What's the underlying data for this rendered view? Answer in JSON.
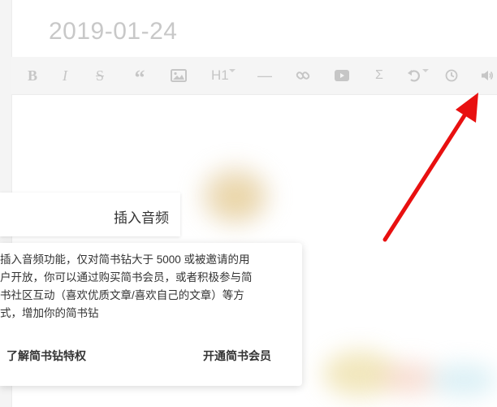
{
  "document": {
    "title": "2019-01-24"
  },
  "toolbar": {
    "buttons": [
      {
        "name": "bold",
        "glyph": "B"
      },
      {
        "name": "italic",
        "glyph": "I"
      },
      {
        "name": "strikethrough",
        "glyph": "S"
      },
      {
        "name": "quote",
        "glyph": "“"
      },
      {
        "name": "image",
        "icon": "image-icon"
      },
      {
        "name": "heading",
        "glyph": "H1"
      },
      {
        "name": "horizontal-rule",
        "glyph": "—"
      },
      {
        "name": "link",
        "icon": "link-icon"
      },
      {
        "name": "video",
        "icon": "video-icon"
      },
      {
        "name": "math",
        "glyph": "Σ"
      },
      {
        "name": "undo",
        "icon": "undo-icon"
      },
      {
        "name": "history",
        "icon": "clock-icon"
      },
      {
        "name": "audio",
        "icon": "speaker-icon"
      }
    ]
  },
  "dialog": {
    "title": "插入音频",
    "lines": [
      "插入音频功能，仅对简书钻大于 5000 或被邀请的用",
      "户开放，你可以通过购买简书会员，或者积极参与简",
      "书社区互动（喜欢优质文章/喜欢自己的文章）等方",
      "式，增加你的简书钻"
    ],
    "learn_more_link": "了解简书钻特权",
    "membership_link": "开通简书会员"
  },
  "colors": {
    "toolbar_bg": "#f5f5f5",
    "toolbar_icon": "#c6c6c6",
    "title_text": "#c8c8c8",
    "arrow": "#e81010",
    "dialog_text": "#333333"
  }
}
